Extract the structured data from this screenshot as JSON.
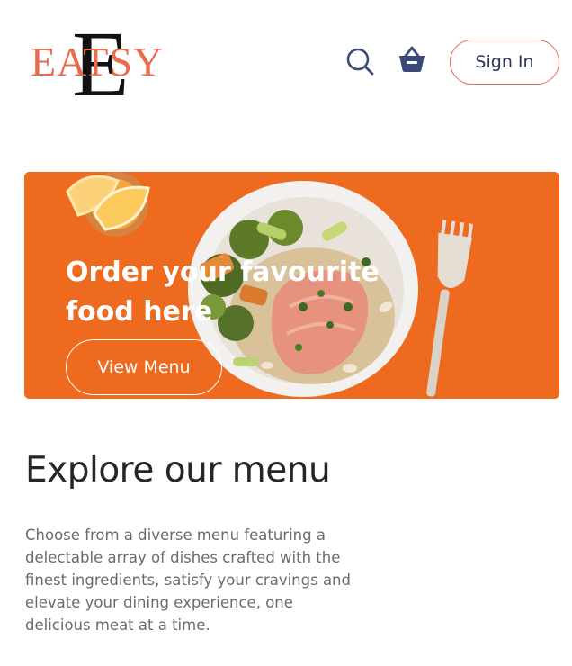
{
  "header": {
    "logo_text": "EATSY",
    "logo_letter": "E",
    "signin_label": "Sign In"
  },
  "icons": {
    "search": "search-icon",
    "cart": "basket-icon"
  },
  "hero": {
    "title": "Order your favourite food here",
    "button_label": "View Menu"
  },
  "explore": {
    "title": "Explore our menu",
    "description": "Choose from a diverse menu featuring a delectable array of dishes crafted with the finest ingredients, satisfy your cravings and elevate your dining experience, one delicious meat at a time."
  },
  "colors": {
    "brand": "#ea6a4e",
    "hero_bg": "#ed6a1f",
    "nav_icon": "#3b4a7a",
    "text_dark": "#262626",
    "text_muted": "#6b6b6b"
  }
}
